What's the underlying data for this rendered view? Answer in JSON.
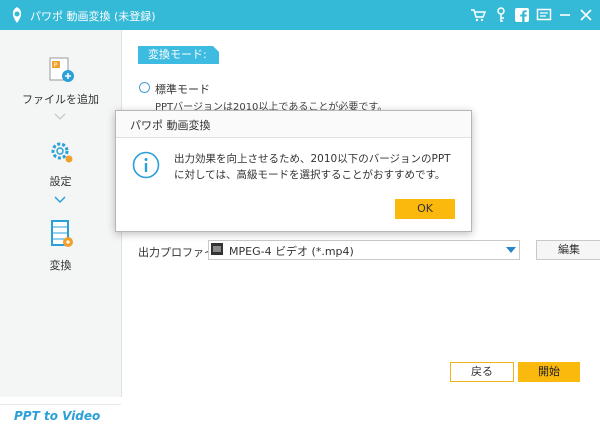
{
  "app": {
    "title": "パワポ 動画変換 (未登録)"
  },
  "titlebar_icons": [
    "cart-icon",
    "key-icon",
    "facebook-icon",
    "message-icon",
    "minimize-icon",
    "close-icon"
  ],
  "sidebar": {
    "items": [
      {
        "label": "ファイルを追加",
        "icon": "add-file-icon"
      },
      {
        "label": "設定",
        "icon": "gear-icon"
      },
      {
        "label": "変換",
        "icon": "film-convert-icon"
      }
    ],
    "brand": "PPT to Video"
  },
  "main": {
    "mode_tag": "変換モード:",
    "mode_standard": "標準モード",
    "mode_standard_desc": "PPTバージョンは2010以上であることが必要です。",
    "profile_label": "出力プロファイル:",
    "profile_value": "MPEG-4 ビデオ (*.mp4)",
    "edit_label": "編集",
    "back_label": "戻る",
    "start_label": "開始"
  },
  "dialog": {
    "title": "パワポ 動画変換",
    "message": "出力効果を向上させるため、2010以下のバージョンのPPTに対しては、高級モードを選択することがおすすめです。",
    "ok_label": "OK"
  },
  "colors": {
    "titlebar": "#34b9d7",
    "accent": "#fbb80d",
    "brand": "#2a9fd8"
  }
}
